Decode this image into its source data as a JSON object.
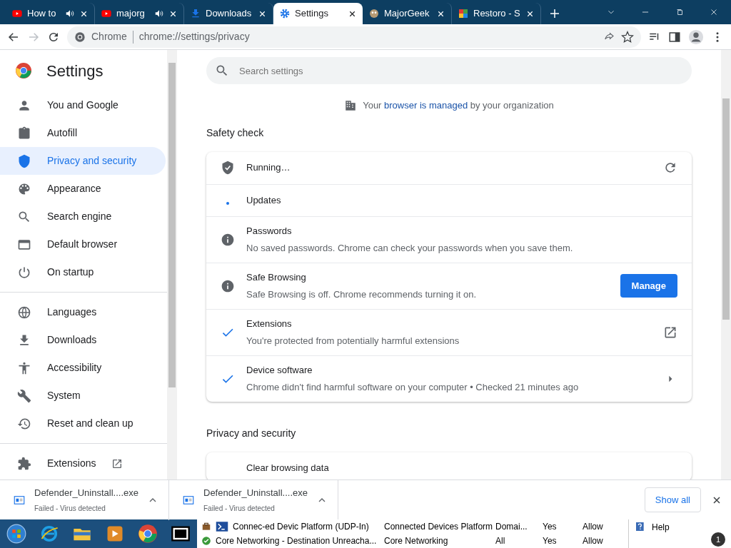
{
  "tabs": [
    {
      "title": "How to",
      "audio": true,
      "selected": false
    },
    {
      "title": "majorg",
      "audio": true,
      "selected": false
    },
    {
      "title": "Downloads",
      "audio": false,
      "selected": false
    },
    {
      "title": "Settings",
      "audio": false,
      "selected": true
    },
    {
      "title": "MajorGeek",
      "audio": false,
      "selected": false
    },
    {
      "title": "Restoro - S",
      "audio": false,
      "selected": false
    }
  ],
  "omnibox": {
    "origin": "Chrome",
    "url": "chrome://settings/privacy"
  },
  "sidebar": {
    "title": "Settings",
    "groups": [
      [
        {
          "label": "You and Google",
          "selected": false
        },
        {
          "label": "Autofill",
          "selected": false
        },
        {
          "label": "Privacy and security",
          "selected": true
        },
        {
          "label": "Appearance",
          "selected": false
        },
        {
          "label": "Search engine",
          "selected": false
        },
        {
          "label": "Default browser",
          "selected": false
        },
        {
          "label": "On startup",
          "selected": false
        }
      ],
      [
        {
          "label": "Languages",
          "selected": false
        },
        {
          "label": "Downloads",
          "selected": false
        },
        {
          "label": "Accessibility",
          "selected": false
        },
        {
          "label": "System",
          "selected": false
        },
        {
          "label": "Reset and clean up",
          "selected": false
        }
      ],
      [
        {
          "label": "Extensions",
          "selected": false
        }
      ]
    ]
  },
  "search": {
    "placeholder": "Search settings"
  },
  "managed_notice": {
    "before": "Your",
    "link": "browser is managed",
    "after": "by your organization"
  },
  "safety_check": {
    "title": "Safety check",
    "rows": [
      {
        "kind": "running",
        "title": "Running…",
        "trailing": {
          "kind": "refresh"
        }
      },
      {
        "kind": "updating",
        "title": "Updates"
      },
      {
        "kind": "info",
        "title": "Passwords",
        "subtitle": "No saved passwords. Chrome can check your passwords when you save them."
      },
      {
        "kind": "info",
        "title": "Safe Browsing",
        "subtitle": "Safe Browsing is off. Chrome recommends turning it on.",
        "trailing": {
          "kind": "button",
          "label": "Manage"
        }
      },
      {
        "kind": "ok",
        "title": "Extensions",
        "subtitle": "You're protected from potentially harmful extensions",
        "trailing": {
          "kind": "external"
        }
      },
      {
        "kind": "ok",
        "title": "Device software",
        "subtitle": "Chrome didn't find harmful software on your computer • Checked 21 minutes ago",
        "trailing": {
          "kind": "chevron"
        }
      }
    ]
  },
  "privacy": {
    "title": "Privacy and security",
    "rows": [
      {
        "title": "Clear browsing data"
      }
    ]
  },
  "downloads": {
    "items": [
      {
        "filename": "Defender_Uninstall....exe",
        "status": "Failed - Virus detected"
      },
      {
        "filename": "Defender_Uninstall....exe",
        "status": "Failed - Virus detected"
      }
    ],
    "show_all": "Show all"
  },
  "background_window": {
    "rows": [
      [
        "Connec-ed Devic Platform (UDP-In)",
        "Connected Devices Platform",
        "Domai...",
        "Yes",
        "Allow"
      ],
      [
        "Core Networking - Destination Unreacha...",
        "Core Networking",
        "All",
        "Yes",
        "Allow"
      ]
    ],
    "help": "Help"
  },
  "taskbar": {
    "badge": "1"
  }
}
